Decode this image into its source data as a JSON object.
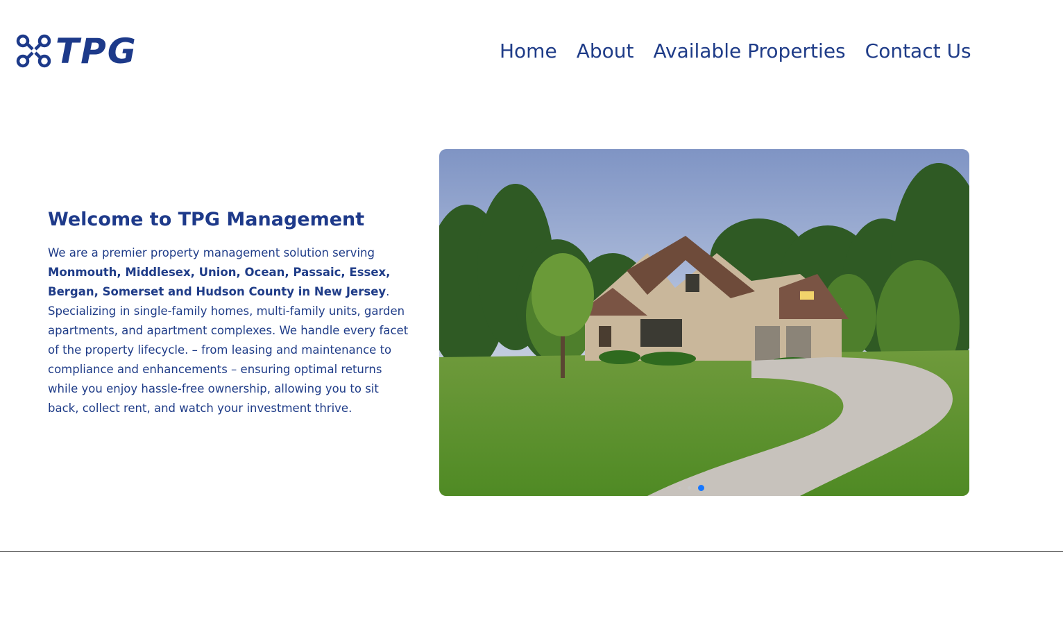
{
  "header": {
    "logo_text": "TPG",
    "nav": [
      {
        "label": "Home"
      },
      {
        "label": "About"
      },
      {
        "label": "Available Properties"
      },
      {
        "label": "Contact Us"
      }
    ]
  },
  "hero": {
    "title": "Welcome to TPG Management",
    "intro": "We are a premier property management solution serving ",
    "counties": "Monmouth, Middlesex, Union, Ocean, Passaic, Essex, Bergan, Somerset and Hudson County in New Jersey",
    "period": ".",
    "rest": " Specializing in single-family homes, multi-family units, garden apartments, and apartment complexes. We handle every facet of the property lifecycle. – from leasing and maintenance to compliance and enhancements – ensuring optimal returns while you enjoy hassle-free ownership, allowing you to sit back, collect rent, and watch your investment thrive."
  },
  "carousel": {
    "image": "suburban-house-photo",
    "slide_count": 3,
    "active_slide": 3
  },
  "colors": {
    "brand_blue": "#1f3c88",
    "dot_active": "#1677ff"
  }
}
